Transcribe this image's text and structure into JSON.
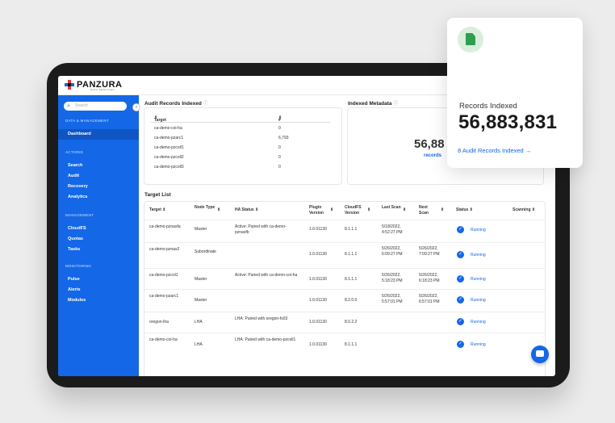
{
  "brand": {
    "name": "PANZURA",
    "sub": "DATA SERVICES"
  },
  "search": {
    "placeholder": "Search"
  },
  "sidebar": {
    "sections": [
      {
        "title": "DATA & MANAGEMENT",
        "items": [
          "Dashboard"
        ]
      },
      {
        "title": "ACTIONS",
        "items": [
          "Search",
          "Audit",
          "Recovery",
          "Analytics"
        ]
      },
      {
        "title": "MANAGEMENT",
        "items": [
          "CloudFS",
          "Quotas",
          "Tasks"
        ]
      },
      {
        "title": "MONITORING",
        "items": [
          "Pulse",
          "Alerts",
          "Modules"
        ]
      }
    ]
  },
  "audit": {
    "title": "Audit Records Indexed",
    "col_target": "Target",
    "col_count": "#",
    "rows": [
      {
        "target": "ca-demo-coi-ha",
        "count": "0"
      },
      {
        "target": "ca-demo-pzarc1",
        "count": "6,793"
      },
      {
        "target": "ca-demo-pzcoll1",
        "count": "0"
      },
      {
        "target": "ca-demo-pzcoll2",
        "count": "0"
      },
      {
        "target": "ca-demo-pzcoll3",
        "count": "0"
      }
    ]
  },
  "metadata": {
    "title": "Indexed Metadata",
    "value": "56,88",
    "label": "records"
  },
  "target_list": {
    "title": "Target List",
    "headers": {
      "target": "Target",
      "node": "Node Type",
      "ha": "HA Status",
      "plugin": "Plugin Version",
      "cloudfs": "CloudFS Version",
      "last": "Last Scan",
      "next": "Next Scan",
      "status": "Status",
      "scanning": "Scanning"
    },
    "rows": [
      {
        "target": "ca-demo-pznasfa",
        "node": "Master",
        "ha": "Active: Paired with ca-demo-pznasfb",
        "plugin": "1.0.01130",
        "cloudfs": "8.1.1.1",
        "last": "5/18/2022, 4:52:27 PM",
        "next": "",
        "status": "Running"
      },
      {
        "target": "ca-demo-pznas2",
        "node": "Subordinate",
        "ha": "",
        "plugin": "1.0.01130",
        "cloudfs": "8.1.1.1",
        "last": "5/26/2022, 6:09:27 PM",
        "next": "5/26/2022, 7:09:27 PM",
        "status": "Running"
      },
      {
        "target": "ca-demo-pzcol1",
        "node": "Master",
        "ha": "Active: Paired with ca-demo-coi-ha",
        "plugin": "1.0.01130",
        "cloudfs": "8.1.1.1",
        "last": "5/26/2022, 5:18:23 PM",
        "next": "5/26/2022, 6:18:23 PM",
        "status": "Running"
      },
      {
        "target": "ca-demo-pzarc1",
        "node": "Master",
        "ha": "",
        "plugin": "1.0.01130",
        "cloudfs": "8.2.0.0",
        "last": "5/26/2022, 5:57:01 PM",
        "next": "5/26/2022, 6:57:01 PM",
        "status": "Running"
      },
      {
        "target": "oregon-lha",
        "node": "LHA",
        "ha": "LHA: Paired with oregon-fs03",
        "plugin": "1.0.01130",
        "cloudfs": "8.0.2.2",
        "last": "",
        "next": "",
        "status": "Running"
      },
      {
        "target": "ca-demo-coi-ha",
        "node": "LHA",
        "ha": "LHA: Paired with ca-demo-pzcoll1",
        "plugin": "1.0.01130",
        "cloudfs": "8.1.1.1",
        "last": "",
        "next": "",
        "status": "Running"
      }
    ]
  },
  "popup": {
    "label": "Records Indexed",
    "value": "56,883,831",
    "link": "8 Audit Records Indexed →"
  },
  "colors": {
    "accent": "#1467e6",
    "sidebar": "#1467e6",
    "success_icon": "#2f9e4f"
  }
}
